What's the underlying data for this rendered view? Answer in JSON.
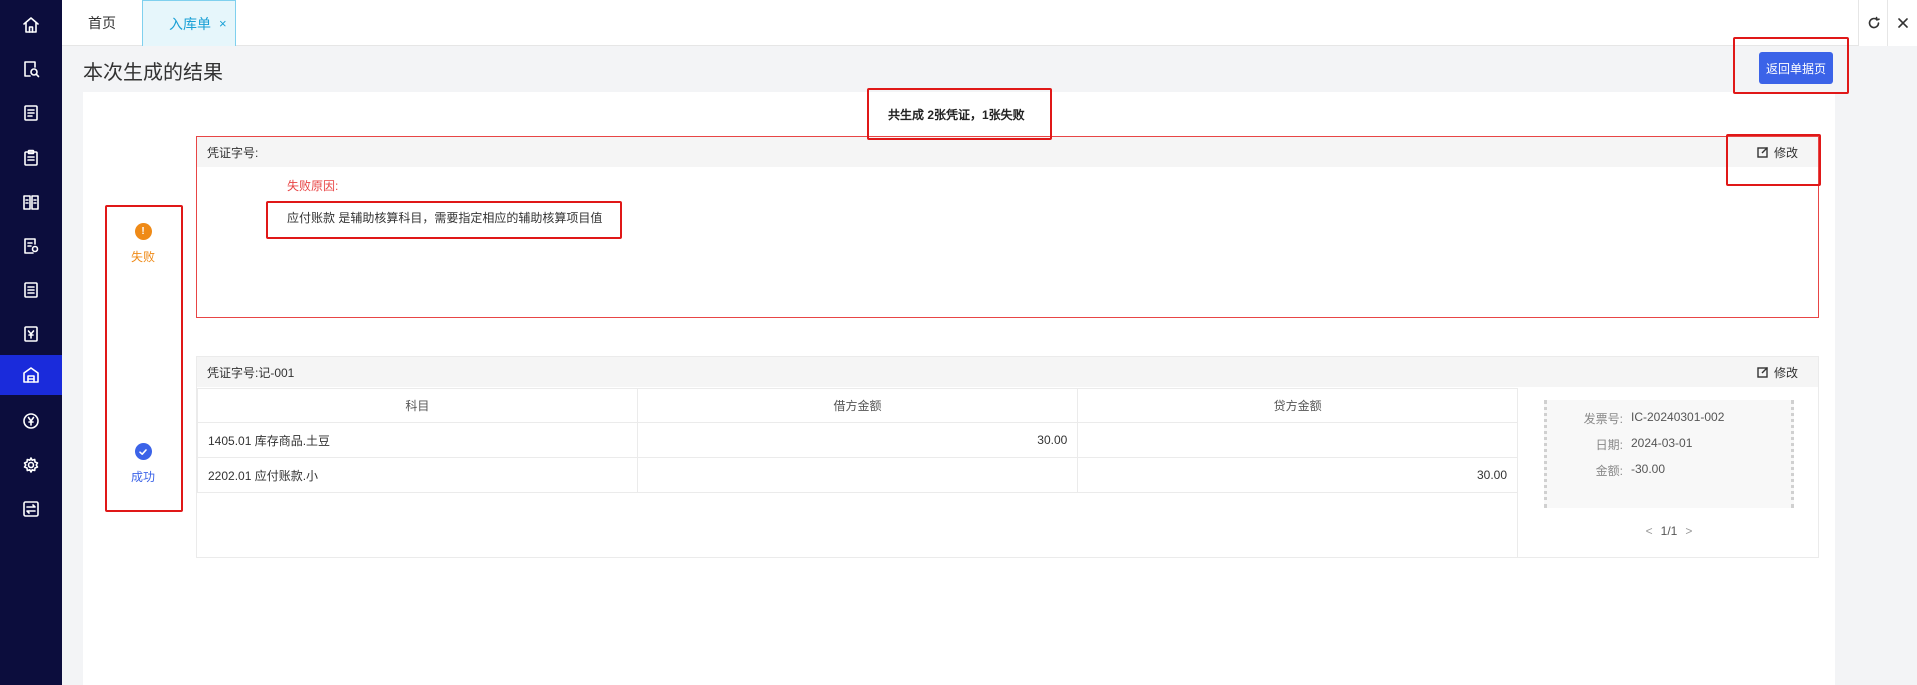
{
  "sidebar": {
    "items": [
      {
        "icon": "home-icon"
      },
      {
        "icon": "document-search-icon"
      },
      {
        "icon": "list-document-icon"
      },
      {
        "icon": "clipboard-icon"
      },
      {
        "icon": "ledger-icon"
      },
      {
        "icon": "document-settings-icon"
      },
      {
        "icon": "notes-icon"
      },
      {
        "icon": "yen-document-icon"
      },
      {
        "icon": "warehouse-icon",
        "active": true
      },
      {
        "icon": "yen-circle-icon"
      },
      {
        "icon": "gear-icon"
      },
      {
        "icon": "transfer-icon"
      }
    ]
  },
  "tabs": {
    "home": "首页",
    "active": "入库单",
    "close": "×"
  },
  "page": {
    "title": "本次生成的结果",
    "back_button": "返回单据页",
    "summary": "共生成 2张凭证，1张失败"
  },
  "status": {
    "fail_icon": "!",
    "fail": "失败",
    "ok": "成功"
  },
  "fail_card": {
    "voucher_label": "凭证字号:",
    "edit": "修改",
    "reason_title": "失败原因:",
    "reason_text": "应付账款 是辅助核算科目，需要指定相应的辅助核算项目值"
  },
  "ok_card": {
    "voucher_label": "凭证字号:记-001",
    "edit": "修改",
    "columns": [
      "科目",
      "借方金额",
      "贷方金额"
    ],
    "rows": [
      {
        "account": "1405.01 库存商品.土豆",
        "debit": "30.00",
        "credit": ""
      },
      {
        "account": "2202.01 应付账款.小",
        "debit": "",
        "credit": "30.00"
      }
    ],
    "invoice": {
      "no_label": "发票号:",
      "no": "IC-20240301-002",
      "date_label": "日期:",
      "date": "2024-03-01",
      "amount_label": "金额:",
      "amount": "-30.00"
    },
    "pager": {
      "prev": "<",
      "page": "1/1",
      "next": ">"
    }
  },
  "colors": {
    "sidebar_bg": "#0c0d3d",
    "sidebar_active": "#1a2bdb",
    "primary": "#3b63e8",
    "fail": "#ef8a17",
    "error": "#e84545",
    "highlight": "#e01818"
  }
}
